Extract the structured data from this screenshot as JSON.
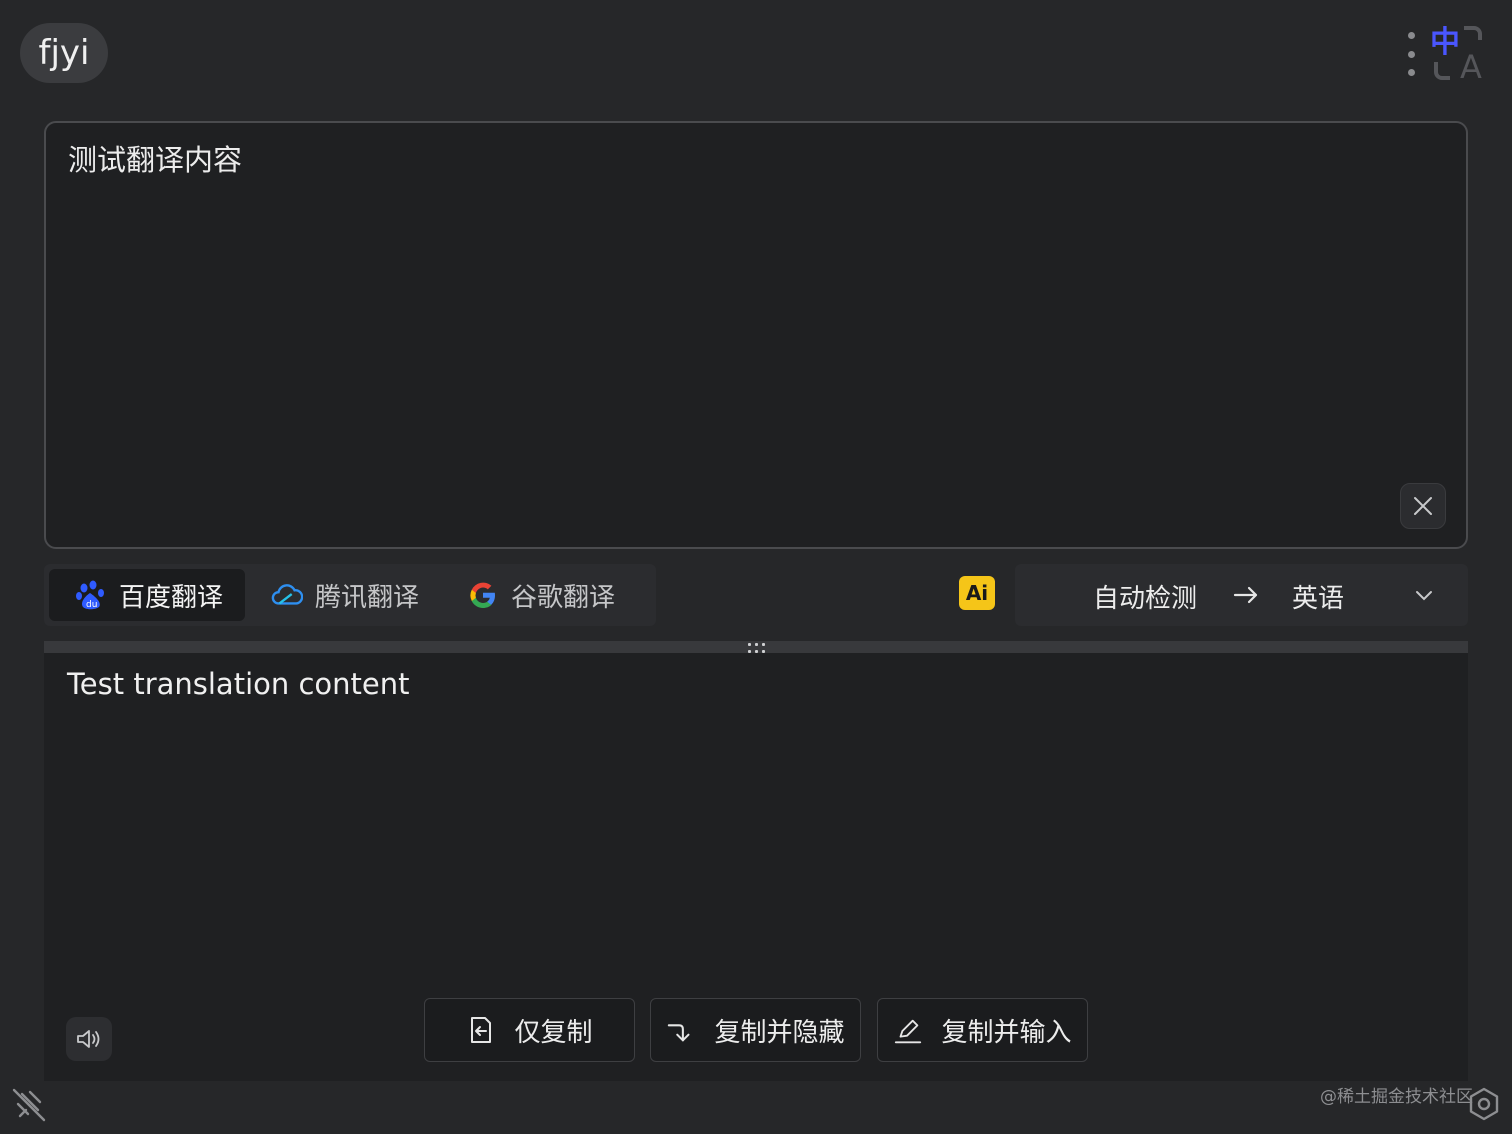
{
  "header": {
    "app_badge": "fjyi",
    "more_icon": "more-vertical-icon",
    "logo_icon": "translate-logo-icon",
    "logo_char": "中",
    "logo_letter": "A"
  },
  "source": {
    "text": "测试翻译内容",
    "clear_icon": "close-icon"
  },
  "engines": [
    {
      "label": "百度翻译",
      "icon": "baidu-icon",
      "active": true
    },
    {
      "label": "腾讯翻译",
      "icon": "tencent-cloud-icon",
      "active": false
    },
    {
      "label": "谷歌翻译",
      "icon": "google-icon",
      "active": false
    }
  ],
  "ai_badge": "Ai",
  "language": {
    "from": "自动检测",
    "to": "英语",
    "arrow_icon": "arrow-right-icon",
    "dropdown_icon": "chevron-down-icon"
  },
  "result": {
    "text": "Test translation content",
    "speak_icon": "speaker-icon"
  },
  "actions": [
    {
      "label": "仅复制",
      "icon": "copy-icon"
    },
    {
      "label": "复制并隐藏",
      "icon": "arrow-down-right-icon"
    },
    {
      "label": "复制并输入",
      "icon": "edit-icon"
    }
  ],
  "footer": {
    "unpin_icon": "unpin-icon",
    "watermark": "@稀土掘金技术社区",
    "settings_icon": "settings-icon"
  },
  "colors": {
    "background": "#262729",
    "panel": "#1f2022",
    "ai_badge": "#f5c518",
    "logo_accent": "#4a56ff"
  }
}
